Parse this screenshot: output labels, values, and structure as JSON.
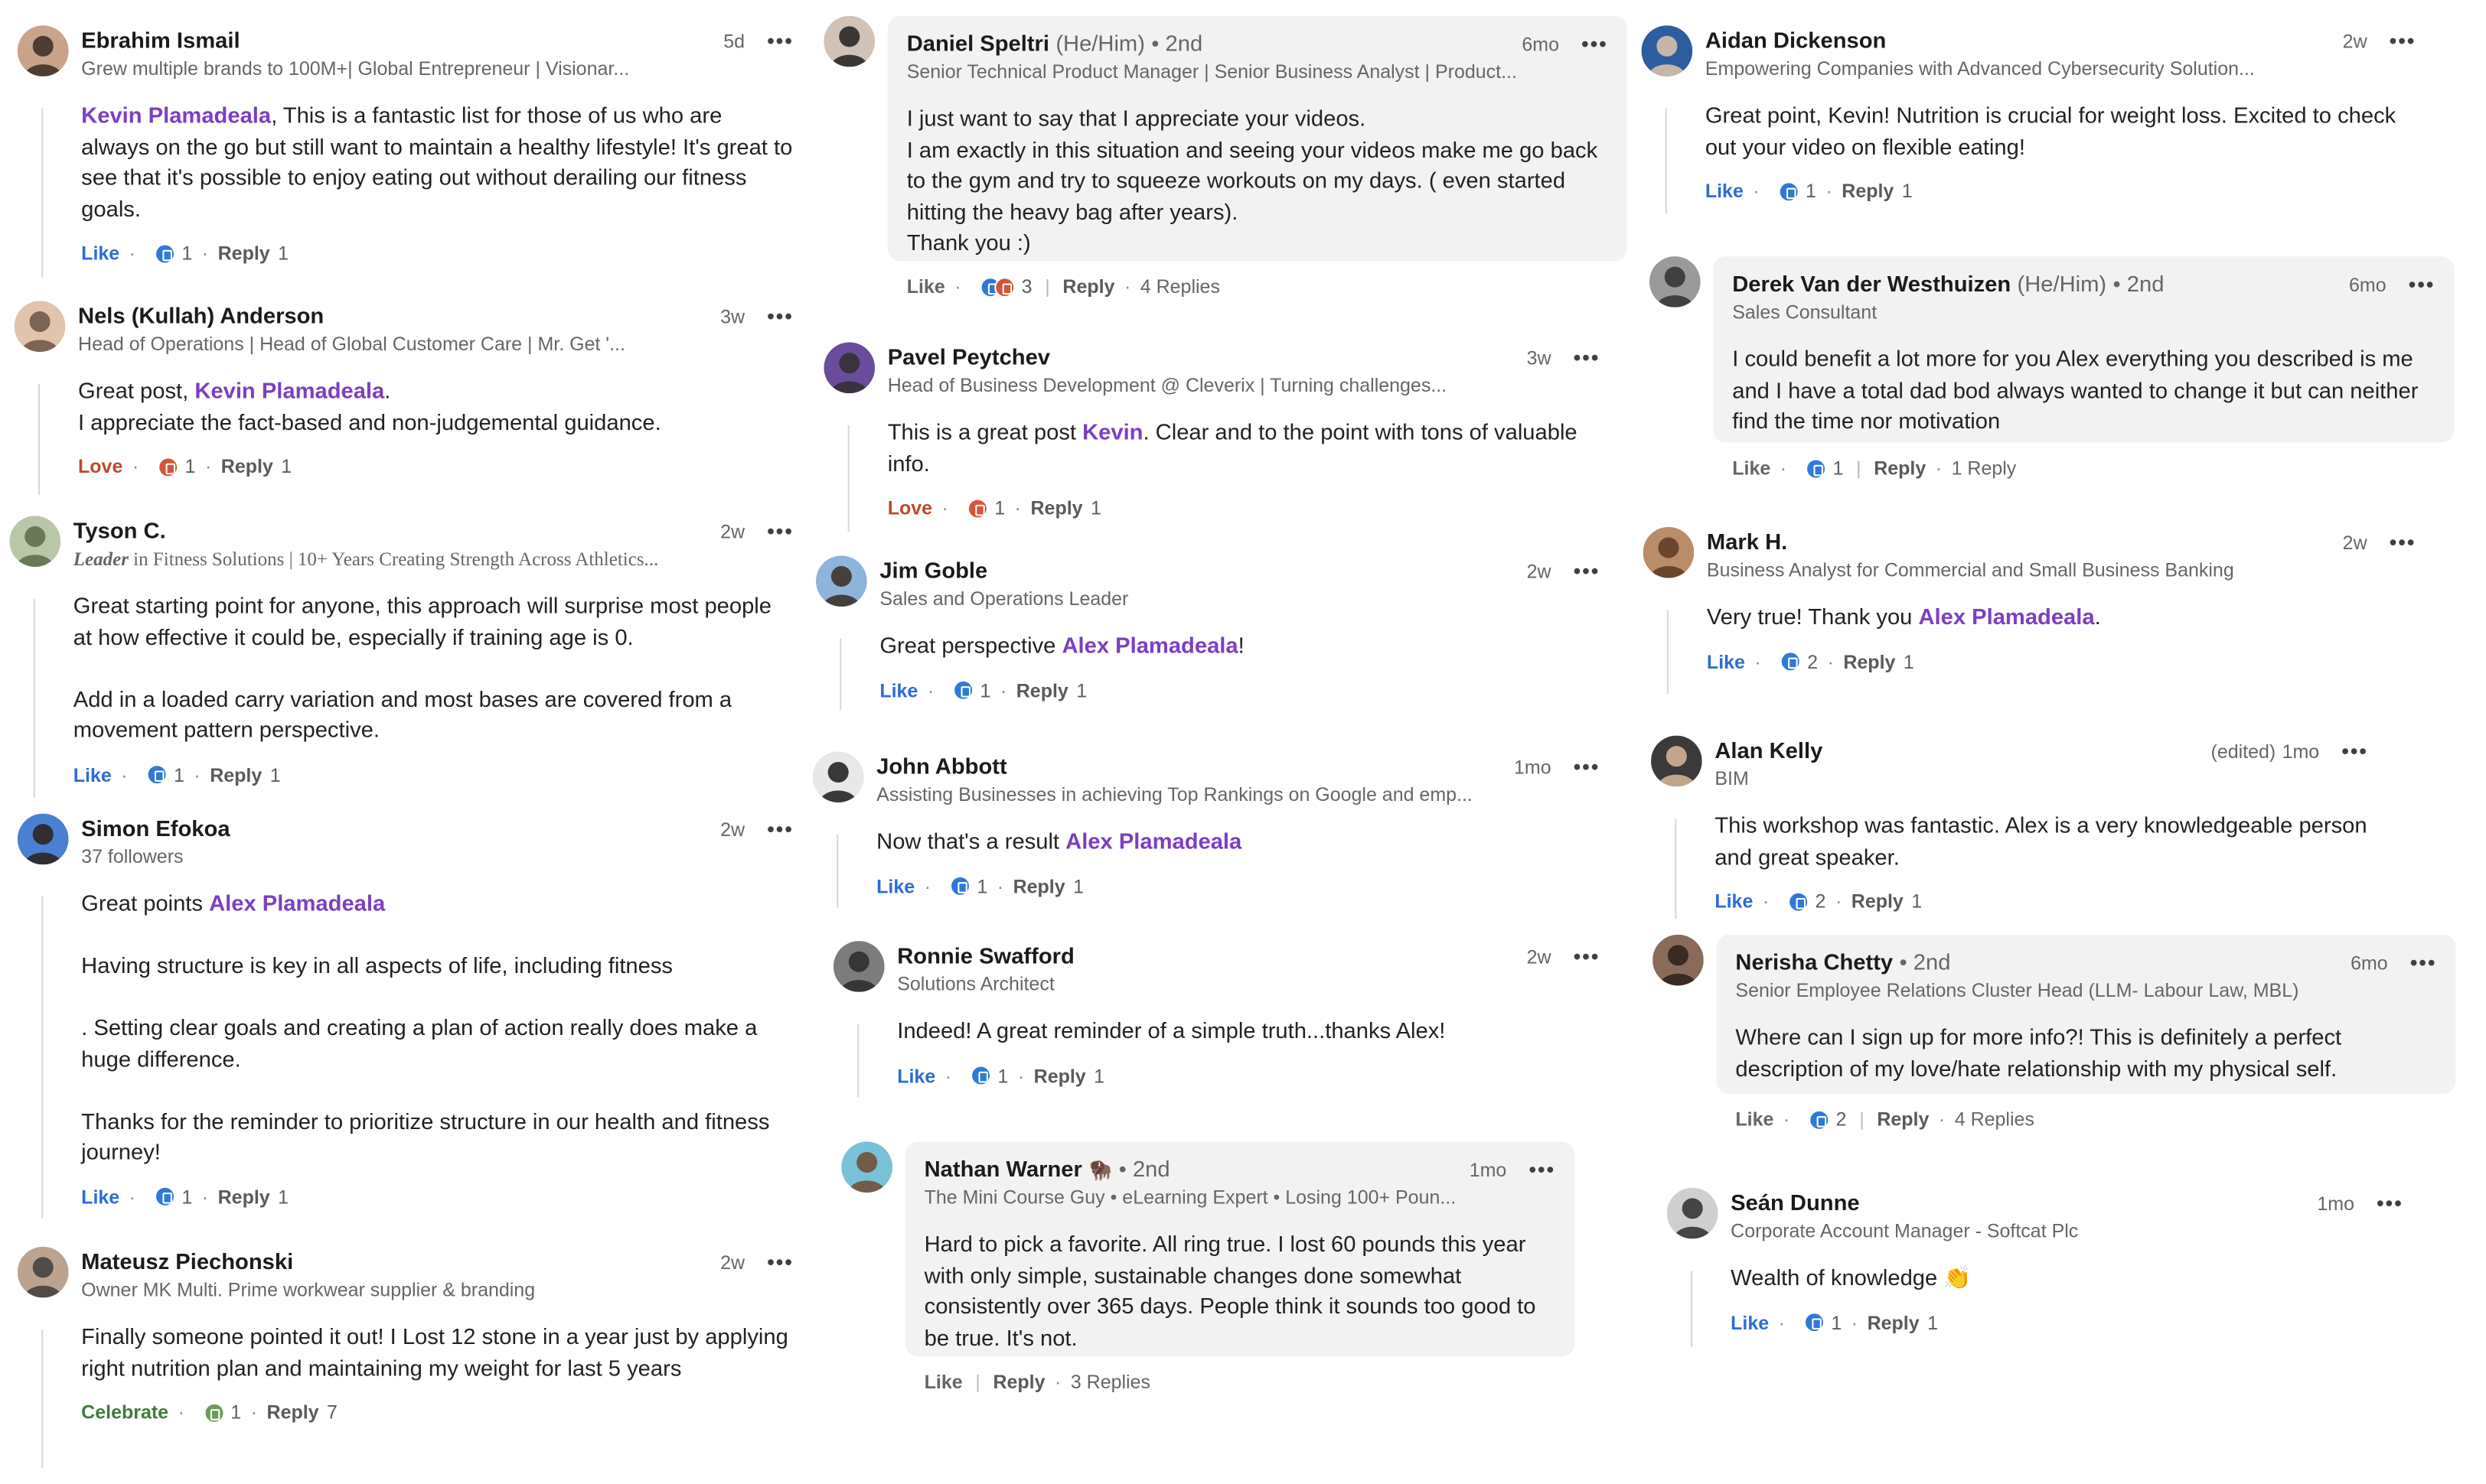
{
  "comments": [
    {
      "name": "Ebrahim Ismail",
      "headline": "Grew multiple brands to 100M+| Global Entrepreneur | Visionar...",
      "time": "5d",
      "lines": [
        [
          {
            "m": "Kevin Plamadeala"
          },
          {
            "t": ", This is a fantastic list for those of us who are always on the go but still want to maintain a healthy lifestyle! It's great to see that it's possible to enjoy eating out without derailing our fitness goals."
          }
        ]
      ],
      "reaction_label": "Like",
      "reaction_count": "1",
      "reply_label": "Reply",
      "reply_count": "1"
    },
    {
      "name": "Nels (Kullah) Anderson",
      "headline": "Head of Operations | Head of Global Customer Care | Mr. Get '...",
      "time": "3w",
      "lines": [
        [
          {
            "t": "Great post, "
          },
          {
            "m": "Kevin Plamadeala"
          },
          {
            "t": "."
          }
        ],
        [
          {
            "t": "I appreciate the fact-based and non-judgemental guidance."
          }
        ]
      ],
      "reaction_label": "Love",
      "reaction_count": "1",
      "reply_label": "Reply",
      "reply_count": "1"
    },
    {
      "name": "Tyson C.",
      "headline_bold": "Leader",
      "headline": " in Fitness Solutions | 10+ Years Creating Strength Across Athletics...",
      "time": "2w",
      "lines": [
        [
          {
            "t": "Great starting point for anyone, this approach will surprise most people at how effective it could be, especially if training age is 0."
          }
        ],
        [],
        [
          {
            "t": "Add in a loaded carry variation and most bases are covered from a movement pattern perspective."
          }
        ]
      ],
      "reaction_label": "Like",
      "reaction_count": "1",
      "reply_label": "Reply",
      "reply_count": "1"
    },
    {
      "name": "Simon Efokoa",
      "headline": "37 followers",
      "time": "2w",
      "lines": [
        [
          {
            "t": "Great points "
          },
          {
            "m": "Alex Plamadeala"
          }
        ],
        [],
        [
          {
            "t": "Having structure is key in all aspects of life, including fitness"
          }
        ],
        [],
        [
          {
            "t": ". Setting clear goals and creating a plan of action really does make a huge difference."
          }
        ],
        [],
        [
          {
            "t": "Thanks for the reminder to prioritize structure in our health and fitness journey!"
          }
        ]
      ],
      "reaction_label": "Like",
      "reaction_count": "1",
      "reply_label": "Reply",
      "reply_count": "1"
    },
    {
      "name": "Mateusz Piechonski",
      "headline": "Owner MK Multi. Prime workwear supplier & branding",
      "time": "2w",
      "lines": [
        [
          {
            "t": "Finally someone pointed it out! I Lost 12 stone in a year just by applying right nutrition plan and maintaining my weight for last 5 years"
          }
        ]
      ],
      "reaction_label": "Celebrate",
      "reaction_count": "1",
      "reply_label": "Reply",
      "reply_count": "7"
    },
    {
      "name": "Daniel Speltri",
      "pronouns": "(He/Him)",
      "degree": "• 2nd",
      "headline": "Senior Technical Product Manager | Senior Business Analyst | Product...",
      "time": "6mo",
      "lines": [
        [
          {
            "t": "I just want to say that I appreciate your videos."
          }
        ],
        [
          {
            "t": "I am exactly in this situation and seeing your videos make me go back to the gym and try to squeeze workouts on my days. ( even started hitting the heavy bag after years)."
          }
        ],
        [
          {
            "t": "Thank you :)"
          }
        ]
      ],
      "reaction_label": "Like",
      "reaction_count": "3",
      "reply_label": "Reply",
      "replies_link": "4 Replies"
    },
    {
      "name": "Pavel Peytchev",
      "headline": "Head of Business Development @ Cleverix | Turning challenges...",
      "time": "3w",
      "lines": [
        [
          {
            "t": "This is a great post "
          },
          {
            "m": "Kevin"
          },
          {
            "t": ". Clear and to the point with tons of valuable info."
          }
        ]
      ],
      "reaction_label": "Love",
      "reaction_count": "1",
      "reply_label": "Reply",
      "reply_count": "1"
    },
    {
      "name": "Jim Goble",
      "headline": "Sales and Operations Leader",
      "time": "2w",
      "lines": [
        [
          {
            "t": "Great perspective "
          },
          {
            "m": "Alex Plamadeala"
          },
          {
            "t": "!"
          }
        ]
      ],
      "reaction_label": "Like",
      "reaction_count": "1",
      "reply_label": "Reply",
      "reply_count": "1"
    },
    {
      "name": "John Abbott",
      "headline": "Assisting Businesses in achieving Top Rankings on Google and emp...",
      "time": "1mo",
      "lines": [
        [
          {
            "t": "Now that's a result "
          },
          {
            "m": "Alex Plamadeala"
          }
        ]
      ],
      "reaction_label": "Like",
      "reaction_count": "1",
      "reply_label": "Reply",
      "reply_count": "1"
    },
    {
      "name": "Ronnie Swafford",
      "headline": "Solutions Architect",
      "time": "2w",
      "lines": [
        [
          {
            "t": "Indeed! A great reminder of a simple truth...thanks Alex!"
          }
        ]
      ],
      "reaction_label": "Like",
      "reaction_count": "1",
      "reply_label": "Reply",
      "reply_count": "1"
    },
    {
      "name": "Nathan Warner",
      "flag": "🦬",
      "degree": "• 2nd",
      "headline": "The Mini Course Guy • eLearning Expert • Losing 100+ Poun...",
      "time": "1mo",
      "lines": [
        [
          {
            "t": "Hard to pick a favorite. All ring true. I lost 60 pounds this year with only simple, sustainable changes done somewhat consistently over 365 days. People think it sounds too good to be true. It's not."
          }
        ]
      ],
      "reaction_label": "Like",
      "reply_label": "Reply",
      "replies_link": "3 Replies"
    },
    {
      "name": "Aidan Dickenson",
      "headline": "Empowering Companies with Advanced Cybersecurity Solution...",
      "time": "2w",
      "lines": [
        [
          {
            "t": "Great point, Kevin! Nutrition is crucial for weight loss. Excited to check out your video on flexible eating!"
          }
        ]
      ],
      "reaction_label": "Like",
      "reaction_count": "1",
      "reply_label": "Reply",
      "reply_count": "1"
    },
    {
      "name": "Derek Van der Westhuizen",
      "pronouns": "(He/Him)",
      "degree": "• 2nd",
      "headline": "Sales Consultant",
      "time": "6mo",
      "lines": [
        [
          {
            "t": "I could benefit a lot more for you Alex everything you described is me and I have a total dad bod always wanted to change it but can neither find the time nor motivation"
          }
        ]
      ],
      "reaction_label": "Like",
      "reaction_count": "1",
      "reply_label": "Reply",
      "replies_link": "1 Reply"
    },
    {
      "name": "Mark H.",
      "headline": "Business Analyst for Commercial and Small Business Banking",
      "time": "2w",
      "lines": [
        [
          {
            "t": "Very true! Thank you "
          },
          {
            "m": "Alex Plamadeala"
          },
          {
            "t": "."
          }
        ]
      ],
      "reaction_label": "Like",
      "reaction_count": "2",
      "reply_label": "Reply",
      "reply_count": "1"
    },
    {
      "name": "Alan Kelly",
      "headline": "BIM",
      "edited": "(edited)",
      "time": "1mo",
      "lines": [
        [
          {
            "t": "This workshop was fantastic. Alex is a very knowledgeable person and great speaker."
          }
        ]
      ],
      "reaction_label": "Like",
      "reaction_count": "2",
      "reply_label": "Reply",
      "reply_count": "1"
    },
    {
      "name": "Nerisha Chetty",
      "degree": "• 2nd",
      "headline": "Senior Employee Relations Cluster Head (LLM- Labour Law, MBL)",
      "time": "6mo",
      "lines": [
        [
          {
            "t": "Where can I sign up for more info?! This is definitely a perfect description of my love/hate relationship with my physical self."
          }
        ]
      ],
      "reaction_label": "Like",
      "reaction_count": "2",
      "reply_label": "Reply",
      "replies_link": "4 Replies"
    },
    {
      "name": "Seán Dunne",
      "headline": "Corporate Account Manager - Softcat Plc",
      "time": "1mo",
      "lines": [
        [
          {
            "t": "Wealth of knowledge 👏"
          }
        ]
      ],
      "reaction_label": "Like",
      "reaction_count": "1",
      "reply_label": "Reply",
      "reply_count": "1"
    }
  ],
  "more_label": "•••"
}
